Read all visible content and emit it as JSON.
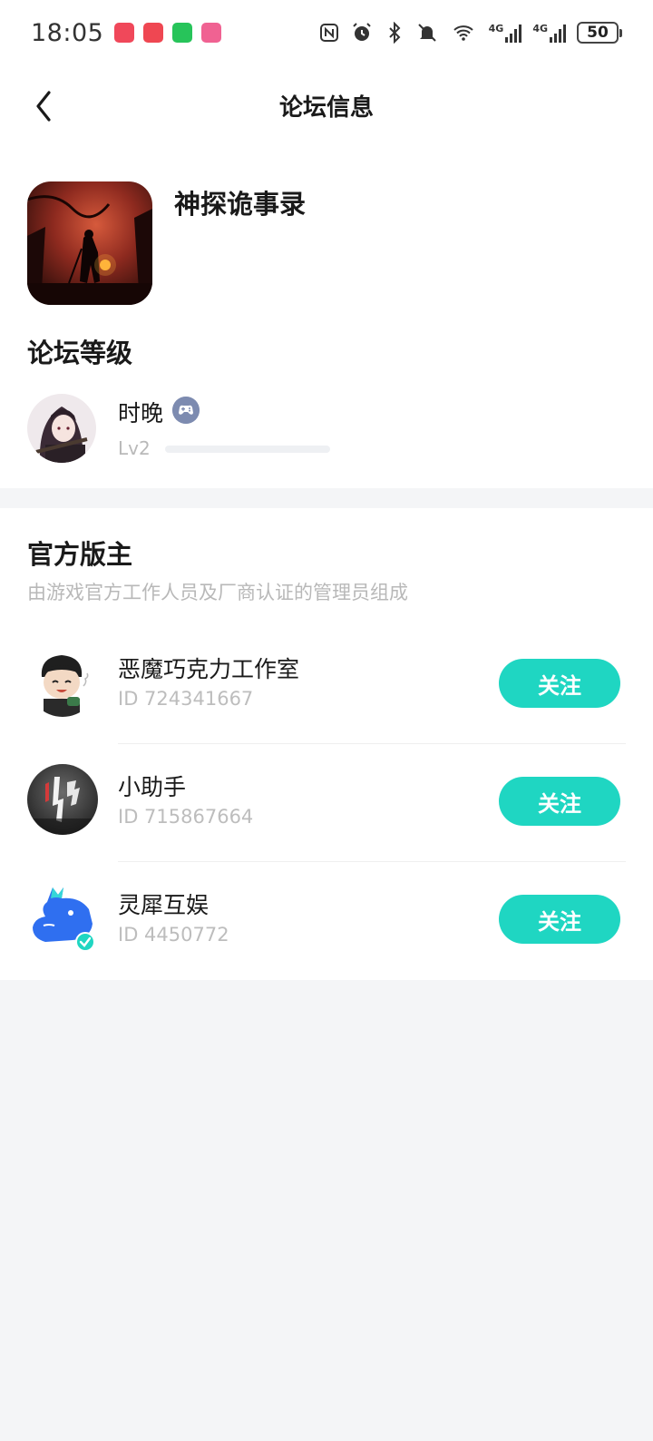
{
  "status_bar": {
    "time": "18:05",
    "battery": "50",
    "signal_label_1": "4G",
    "signal_label_2": "4G"
  },
  "header": {
    "title": "论坛信息"
  },
  "forum": {
    "game_name": "神探诡事录",
    "level_section_title": "论坛等级",
    "user": {
      "name": "时晚",
      "level": "Lv2",
      "level_progress": 0.0
    }
  },
  "moderators": {
    "title": "官方版主",
    "description": "由游戏官方工作人员及厂商认证的管理员组成",
    "items": [
      {
        "name": "恶魔巧克力工作室",
        "id": "ID 724341667",
        "follow_label": "关注"
      },
      {
        "name": "小助手",
        "id": "ID 715867664",
        "follow_label": "关注"
      },
      {
        "name": "灵犀互娱",
        "id": "ID 4450772",
        "follow_label": "关注"
      }
    ]
  },
  "colors": {
    "accent": "#1fd6c2",
    "background": "#f4f5f7"
  }
}
